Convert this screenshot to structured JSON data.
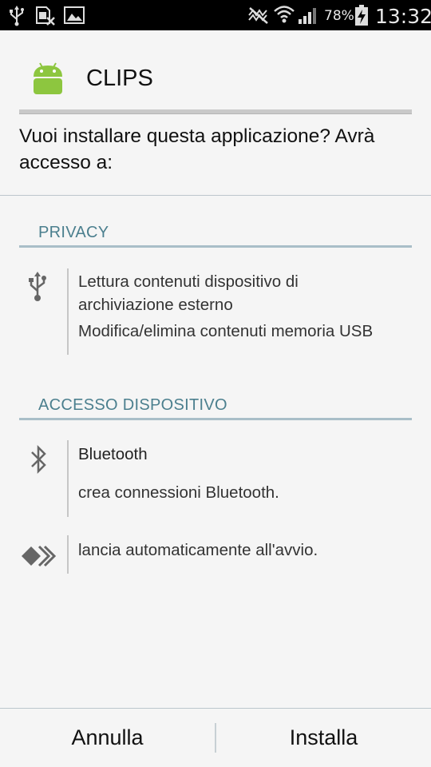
{
  "status_bar": {
    "battery": "78%",
    "time": "13:32",
    "left_icons": [
      "usb-icon",
      "sim-blocked-icon",
      "image-icon"
    ],
    "right_icons": [
      "silent-mode-icon",
      "wifi-icon",
      "signal-icon",
      "battery-charging-icon"
    ]
  },
  "app": {
    "name": "CLIPS",
    "icon": "android-icon"
  },
  "prompt": {
    "line1": "Vuoi installare questa applicazione? Avrà",
    "line2": "accesso a:"
  },
  "sections": {
    "privacy": {
      "title": "PRIVACY",
      "icon": "usb-icon",
      "perm1_line1": "Lettura contenuti dispositivo di",
      "perm1_line2": "archiviazione esterno",
      "perm2": "Modifica/elimina contenuti memoria USB"
    },
    "device": {
      "title": "ACCESSO DISPOSITIVO",
      "bluetooth_icon": "bluetooth-icon",
      "bluetooth_title": "Bluetooth",
      "bluetooth_desc": "crea connessioni Bluetooth.",
      "startup_icon": "startup-icon",
      "startup_desc": "lancia automaticamente all'avvio."
    }
  },
  "buttons": {
    "cancel": "Annulla",
    "install": "Installa"
  },
  "colors": {
    "section_title": "#4b7f8e",
    "section_rule": "#a9bec8",
    "android_green": "#8dc63f"
  }
}
